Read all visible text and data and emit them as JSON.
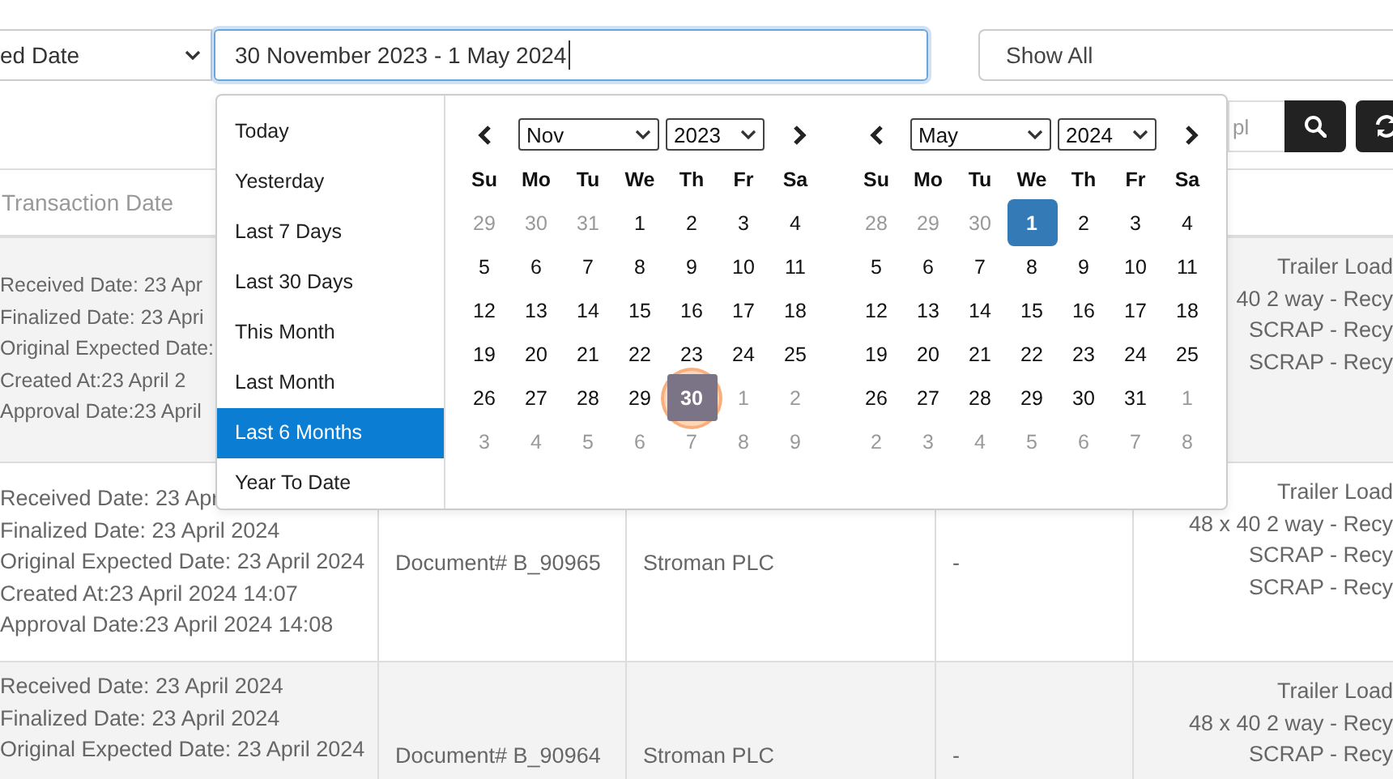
{
  "filters": {
    "date_type_select": {
      "value": "ed Date"
    },
    "date_range_field": {
      "value": "30 November 2023 - 1 May 2024"
    },
    "status_select": {
      "value": "Show All"
    }
  },
  "search": {
    "placeholder": "pl"
  },
  "table": {
    "columns": [
      "Transaction Date"
    ],
    "rows": [
      {
        "dates": [
          "Received Date: 23 Apr",
          "Finalized Date: 23 Apri",
          "Original Expected Date:",
          "Created At:23 April 2",
          "Approval Date:23 April"
        ],
        "items": [
          "Trailer Load",
          "40 2 way - Recy",
          "SCRAP - Recy",
          "SCRAP - Recy"
        ]
      },
      {
        "dates": [
          "Received Date: 23 Apr",
          "Finalized Date: 23 April 2024",
          "Original Expected Date: 23 April 2024",
          "Created At:23 April 2024 14:07",
          "Approval Date:23 April 2024 14:08"
        ],
        "document": "Document# B_90965",
        "company": "Stroman PLC",
        "column_4": "-",
        "items": [
          "Trailer Load",
          "48 x 40 2 way - Recy",
          "SCRAP - Recy",
          "SCRAP - Recy"
        ]
      },
      {
        "dates": [
          "Received Date: 23 April 2024",
          "Finalized Date: 23 April 2024",
          "Original Expected Date: 23 April 2024"
        ],
        "document": "Document# B_90964",
        "company": "Stroman PLC",
        "column_4": "-",
        "items": [
          "Trailer Load",
          "48 x 40 2 way - Recy",
          "SCRAP - Recy"
        ]
      }
    ]
  },
  "popup": {
    "ranges": [
      {
        "label": "Today",
        "selected": false
      },
      {
        "label": "Yesterday",
        "selected": false
      },
      {
        "label": "Last 7 Days",
        "selected": false
      },
      {
        "label": "Last 30 Days",
        "selected": false
      },
      {
        "label": "This Month",
        "selected": false
      },
      {
        "label": "Last Month",
        "selected": false
      },
      {
        "label": "Last 6 Months",
        "selected": true
      },
      {
        "label": "Year To Date",
        "selected": false
      }
    ],
    "calendars": [
      {
        "month": "Nov",
        "year": "2023",
        "weekdays": [
          "Su",
          "Mo",
          "Tu",
          "We",
          "Th",
          "Fr",
          "Sa"
        ],
        "weeks": [
          [
            {
              "day": "29",
              "muted": true,
              "selected": false,
              "clicked": false
            },
            {
              "day": "30",
              "muted": true,
              "selected": false,
              "clicked": false
            },
            {
              "day": "31",
              "muted": true,
              "selected": false,
              "clicked": false
            },
            {
              "day": "1",
              "muted": false,
              "selected": false,
              "clicked": false
            },
            {
              "day": "2",
              "muted": false,
              "selected": false,
              "clicked": false
            },
            {
              "day": "3",
              "muted": false,
              "selected": false,
              "clicked": false
            },
            {
              "day": "4",
              "muted": false,
              "selected": false,
              "clicked": false
            }
          ],
          [
            {
              "day": "5",
              "muted": false,
              "selected": false,
              "clicked": false
            },
            {
              "day": "6",
              "muted": false,
              "selected": false,
              "clicked": false
            },
            {
              "day": "7",
              "muted": false,
              "selected": false,
              "clicked": false
            },
            {
              "day": "8",
              "muted": false,
              "selected": false,
              "clicked": false
            },
            {
              "day": "9",
              "muted": false,
              "selected": false,
              "clicked": false
            },
            {
              "day": "10",
              "muted": false,
              "selected": false,
              "clicked": false
            },
            {
              "day": "11",
              "muted": false,
              "selected": false,
              "clicked": false
            }
          ],
          [
            {
              "day": "12",
              "muted": false,
              "selected": false,
              "clicked": false
            },
            {
              "day": "13",
              "muted": false,
              "selected": false,
              "clicked": false
            },
            {
              "day": "14",
              "muted": false,
              "selected": false,
              "clicked": false
            },
            {
              "day": "15",
              "muted": false,
              "selected": false,
              "clicked": false
            },
            {
              "day": "16",
              "muted": false,
              "selected": false,
              "clicked": false
            },
            {
              "day": "17",
              "muted": false,
              "selected": false,
              "clicked": false
            },
            {
              "day": "18",
              "muted": false,
              "selected": false,
              "clicked": false
            }
          ],
          [
            {
              "day": "19",
              "muted": false,
              "selected": false,
              "clicked": false
            },
            {
              "day": "20",
              "muted": false,
              "selected": false,
              "clicked": false
            },
            {
              "day": "21",
              "muted": false,
              "selected": false,
              "clicked": false
            },
            {
              "day": "22",
              "muted": false,
              "selected": false,
              "clicked": false
            },
            {
              "day": "23",
              "muted": false,
              "selected": false,
              "clicked": false
            },
            {
              "day": "24",
              "muted": false,
              "selected": false,
              "clicked": false
            },
            {
              "day": "25",
              "muted": false,
              "selected": false,
              "clicked": false
            }
          ],
          [
            {
              "day": "26",
              "muted": false,
              "selected": false,
              "clicked": false
            },
            {
              "day": "27",
              "muted": false,
              "selected": false,
              "clicked": false
            },
            {
              "day": "28",
              "muted": false,
              "selected": false,
              "clicked": false
            },
            {
              "day": "29",
              "muted": false,
              "selected": false,
              "clicked": false
            },
            {
              "day": "30",
              "muted": false,
              "selected": true,
              "clicked": true
            },
            {
              "day": "1",
              "muted": true,
              "selected": false,
              "clicked": false
            },
            {
              "day": "2",
              "muted": true,
              "selected": false,
              "clicked": false
            }
          ],
          [
            {
              "day": "3",
              "muted": true,
              "selected": false,
              "clicked": false
            },
            {
              "day": "4",
              "muted": true,
              "selected": false,
              "clicked": false
            },
            {
              "day": "5",
              "muted": true,
              "selected": false,
              "clicked": false
            },
            {
              "day": "6",
              "muted": true,
              "selected": false,
              "clicked": false
            },
            {
              "day": "7",
              "muted": true,
              "selected": false,
              "clicked": false
            },
            {
              "day": "8",
              "muted": true,
              "selected": false,
              "clicked": false
            },
            {
              "day": "9",
              "muted": true,
              "selected": false,
              "clicked": false
            }
          ]
        ]
      },
      {
        "month": "May",
        "year": "2024",
        "weekdays": [
          "Su",
          "Mo",
          "Tu",
          "We",
          "Th",
          "Fr",
          "Sa"
        ],
        "weeks": [
          [
            {
              "day": "28",
              "muted": true,
              "selected": false,
              "clicked": false
            },
            {
              "day": "29",
              "muted": true,
              "selected": false,
              "clicked": false
            },
            {
              "day": "30",
              "muted": true,
              "selected": false,
              "clicked": false
            },
            {
              "day": "1",
              "muted": false,
              "selected": true,
              "clicked": false
            },
            {
              "day": "2",
              "muted": false,
              "selected": false,
              "clicked": false
            },
            {
              "day": "3",
              "muted": false,
              "selected": false,
              "clicked": false
            },
            {
              "day": "4",
              "muted": false,
              "selected": false,
              "clicked": false
            }
          ],
          [
            {
              "day": "5",
              "muted": false,
              "selected": false,
              "clicked": false
            },
            {
              "day": "6",
              "muted": false,
              "selected": false,
              "clicked": false
            },
            {
              "day": "7",
              "muted": false,
              "selected": false,
              "clicked": false
            },
            {
              "day": "8",
              "muted": false,
              "selected": false,
              "clicked": false
            },
            {
              "day": "9",
              "muted": false,
              "selected": false,
              "clicked": false
            },
            {
              "day": "10",
              "muted": false,
              "selected": false,
              "clicked": false
            },
            {
              "day": "11",
              "muted": false,
              "selected": false,
              "clicked": false
            }
          ],
          [
            {
              "day": "12",
              "muted": false,
              "selected": false,
              "clicked": false
            },
            {
              "day": "13",
              "muted": false,
              "selected": false,
              "clicked": false
            },
            {
              "day": "14",
              "muted": false,
              "selected": false,
              "clicked": false
            },
            {
              "day": "15",
              "muted": false,
              "selected": false,
              "clicked": false
            },
            {
              "day": "16",
              "muted": false,
              "selected": false,
              "clicked": false
            },
            {
              "day": "17",
              "muted": false,
              "selected": false,
              "clicked": false
            },
            {
              "day": "18",
              "muted": false,
              "selected": false,
              "clicked": false
            }
          ],
          [
            {
              "day": "19",
              "muted": false,
              "selected": false,
              "clicked": false
            },
            {
              "day": "20",
              "muted": false,
              "selected": false,
              "clicked": false
            },
            {
              "day": "21",
              "muted": false,
              "selected": false,
              "clicked": false
            },
            {
              "day": "22",
              "muted": false,
              "selected": false,
              "clicked": false
            },
            {
              "day": "23",
              "muted": false,
              "selected": false,
              "clicked": false
            },
            {
              "day": "24",
              "muted": false,
              "selected": false,
              "clicked": false
            },
            {
              "day": "25",
              "muted": false,
              "selected": false,
              "clicked": false
            }
          ],
          [
            {
              "day": "26",
              "muted": false,
              "selected": false,
              "clicked": false
            },
            {
              "day": "27",
              "muted": false,
              "selected": false,
              "clicked": false
            },
            {
              "day": "28",
              "muted": false,
              "selected": false,
              "clicked": false
            },
            {
              "day": "29",
              "muted": false,
              "selected": false,
              "clicked": false
            },
            {
              "day": "30",
              "muted": false,
              "selected": false,
              "clicked": false
            },
            {
              "day": "31",
              "muted": false,
              "selected": false,
              "clicked": false
            },
            {
              "day": "1",
              "muted": true,
              "selected": false,
              "clicked": false
            }
          ],
          [
            {
              "day": "2",
              "muted": true,
              "selected": false,
              "clicked": false
            },
            {
              "day": "3",
              "muted": true,
              "selected": false,
              "clicked": false
            },
            {
              "day": "4",
              "muted": true,
              "selected": false,
              "clicked": false
            },
            {
              "day": "5",
              "muted": true,
              "selected": false,
              "clicked": false
            },
            {
              "day": "6",
              "muted": true,
              "selected": false,
              "clicked": false
            },
            {
              "day": "7",
              "muted": true,
              "selected": false,
              "clicked": false
            },
            {
              "day": "8",
              "muted": true,
              "selected": false,
              "clicked": false
            }
          ]
        ]
      }
    ]
  }
}
